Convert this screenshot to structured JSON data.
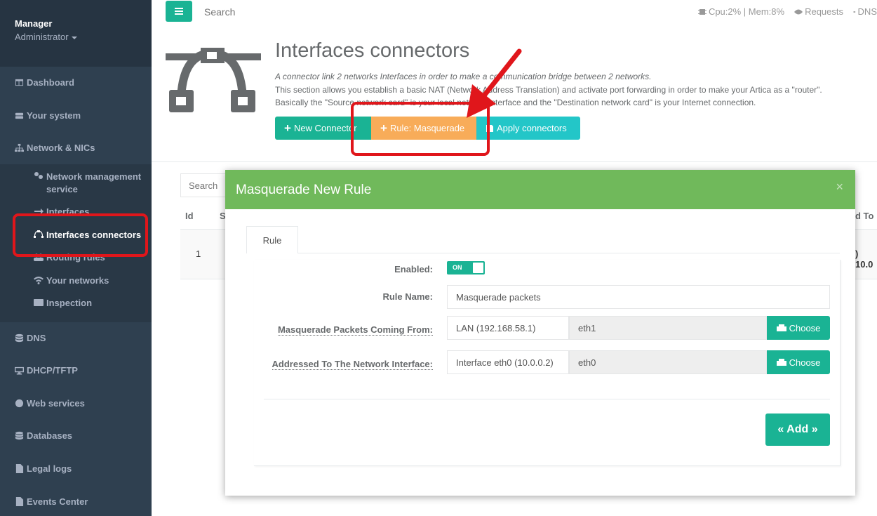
{
  "sidebar": {
    "profile_name": "Manager",
    "profile_role": "Administrator",
    "items": [
      {
        "label": "Dashboard",
        "icon": "dashboard-icon"
      },
      {
        "label": "Your system",
        "icon": "hdd-icon"
      },
      {
        "label": "Network & NICs",
        "icon": "sitemap-icon"
      },
      {
        "label": "DNS",
        "icon": "database-icon"
      },
      {
        "label": "DHCP/TFTP",
        "icon": "desktop-icon"
      },
      {
        "label": "Web services",
        "icon": "globe-icon"
      },
      {
        "label": "Databases",
        "icon": "database-icon"
      },
      {
        "label": "Legal logs",
        "icon": "file-icon"
      },
      {
        "label": "Events Center",
        "icon": "file-icon"
      }
    ],
    "subitems": [
      {
        "label": "Network management service",
        "icon": "cogs-icon"
      },
      {
        "label": "Interfaces",
        "icon": "arrow-right-icon"
      },
      {
        "label": "Interfaces connectors",
        "icon": "bezier-icon"
      },
      {
        "label": "Routing rules",
        "icon": "users-icon"
      },
      {
        "label": "Your networks",
        "icon": "wifi-icon"
      },
      {
        "label": "Inspection",
        "icon": "id-card-icon"
      }
    ]
  },
  "topbar": {
    "search_placeholder": "Search",
    "cpu_mem": "Cpu:2% | Mem:8%",
    "requests": "Requests",
    "dns": "DNS"
  },
  "header": {
    "title": "Interfaces connectors",
    "desc_line1": "A connector link 2 networks Interfaces in order to make a communication bridge between 2 networks.",
    "desc_line2": "This section allows you establish a basic NAT (Network Address Translation) and activate port forwarding in order to make your Artica as a \"router\".",
    "desc_line3": "Basically the \"Source network card\" is your local network interface and the \"Destination network card\" is your Internet connection.",
    "btn_new": "New Connector",
    "btn_rule": "Rule: Masquerade",
    "btn_apply": "Apply connectors"
  },
  "table": {
    "search_placeholder": "Search",
    "col_id": "Id",
    "col_s": "S",
    "col_to": "d To",
    "row_id": "1",
    "row_val": ") 10.0"
  },
  "modal": {
    "title": "Masquerade New Rule",
    "close": "×",
    "tab": "Rule",
    "enabled_label": "Enabled:",
    "toggle_text": "ON",
    "rule_name_label": "Rule Name:",
    "rule_name_value": "Masquerade packets",
    "from_label": "Masquerade Packets Coming From:",
    "from_value": "LAN (192.168.58.1)",
    "from_iface": "eth1",
    "to_label": "Addressed To The Network Interface:",
    "to_value": "Interface eth0 (10.0.0.2)",
    "to_iface": "eth0",
    "choose_label": "Choose",
    "add_label": "« Add »"
  },
  "colors": {
    "primary": "#1ab394",
    "warning": "#f8ac59",
    "info": "#23c6c8",
    "modal_header": "#70b95b",
    "annotation": "#e0161b",
    "sidebar": "#2f4050"
  }
}
